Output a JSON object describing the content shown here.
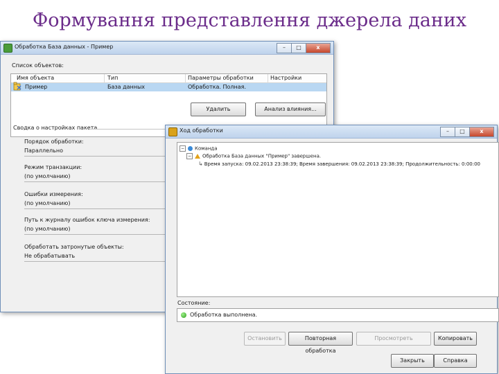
{
  "slide": {
    "title": "Формування представлення джерела даних"
  },
  "main_window": {
    "title": "Обработка База данных - Пример",
    "controls": {
      "minimize": "–",
      "maximize": "□",
      "close": "x"
    },
    "objects_label": "Список объектов:",
    "columns": [
      "Имя объекта",
      "Тип",
      "Параметры обработки",
      "Настройки"
    ],
    "rows": [
      {
        "name": "Пример",
        "type": "База данных",
        "params": "Обработка. Полная.",
        "settings": ""
      }
    ],
    "buttons": {
      "delete": "Удалить",
      "impact": "Анализ влияния..."
    },
    "batch_label": "Сводка о настройках пакета",
    "settings": [
      {
        "label": "Порядок обработки:",
        "value": "Параллельно"
      },
      {
        "label": "Режим транзакции:",
        "value": "(по умолчанию)"
      },
      {
        "label": "Ошибки измерения:",
        "value": "(по умолчанию)"
      },
      {
        "label": "Путь к журналу ошибок ключа измерения:",
        "value": "(по умолчанию)"
      },
      {
        "label": "Обработать затронутые объекты:",
        "value": "Не обрабатывать"
      }
    ]
  },
  "log_window": {
    "title": "Ход обработки",
    "controls": {
      "minimize": "–",
      "maximize": "□",
      "close": "x"
    },
    "tree": {
      "root": "Команда",
      "item": "Обработка База данных \"Пример\" завершена.",
      "detail": "Время запуска: 09.02.2013 23:38:39; Время завершения: 09.02.2013 23:38:39; Продолжительность: 0:00:00"
    },
    "status_label": "Состояние:",
    "status_text": "Обработка выполнена.",
    "buttons": {
      "stop": "Остановить",
      "reprocess": "Повторная обработка",
      "view_details": "Просмотреть",
      "copy": "Копировать",
      "close": "Закрыть",
      "help": "Справка"
    }
  }
}
